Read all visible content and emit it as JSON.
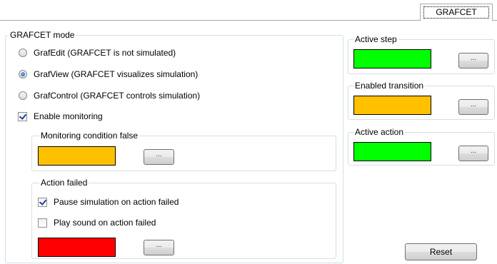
{
  "tab": {
    "label": "GRAFCET"
  },
  "grafcet_mode": {
    "title": "GRAFCET mode",
    "options": [
      {
        "label": "GrafEdit (GRAFCET is not simulated)",
        "selected": false
      },
      {
        "label": "GrafView (GRAFCET visualizes simulation)",
        "selected": true
      },
      {
        "label": "GrafControl (GRAFCET controls simulation)",
        "selected": false
      }
    ],
    "enable_monitoring": {
      "label": "Enable monitoring",
      "checked": true
    },
    "monitoring_condition": {
      "title": "Monitoring condition false",
      "color": "#ffc000",
      "button_label": "..."
    },
    "action_failed": {
      "title": "Action failed",
      "pause": {
        "label": "Pause simulation on action failed",
        "checked": true
      },
      "sound": {
        "label": "Play sound on action failed",
        "checked": false
      },
      "color": "#ff0000",
      "button_label": "..."
    }
  },
  "active_step": {
    "title": "Active step",
    "color": "#00ff00",
    "button_label": "..."
  },
  "enabled_transition": {
    "title": "Enabled transition",
    "color": "#ffc000",
    "button_label": "..."
  },
  "active_action": {
    "title": "Active action",
    "color": "#00ff00",
    "button_label": "..."
  },
  "reset_button": {
    "label": "Reset"
  }
}
